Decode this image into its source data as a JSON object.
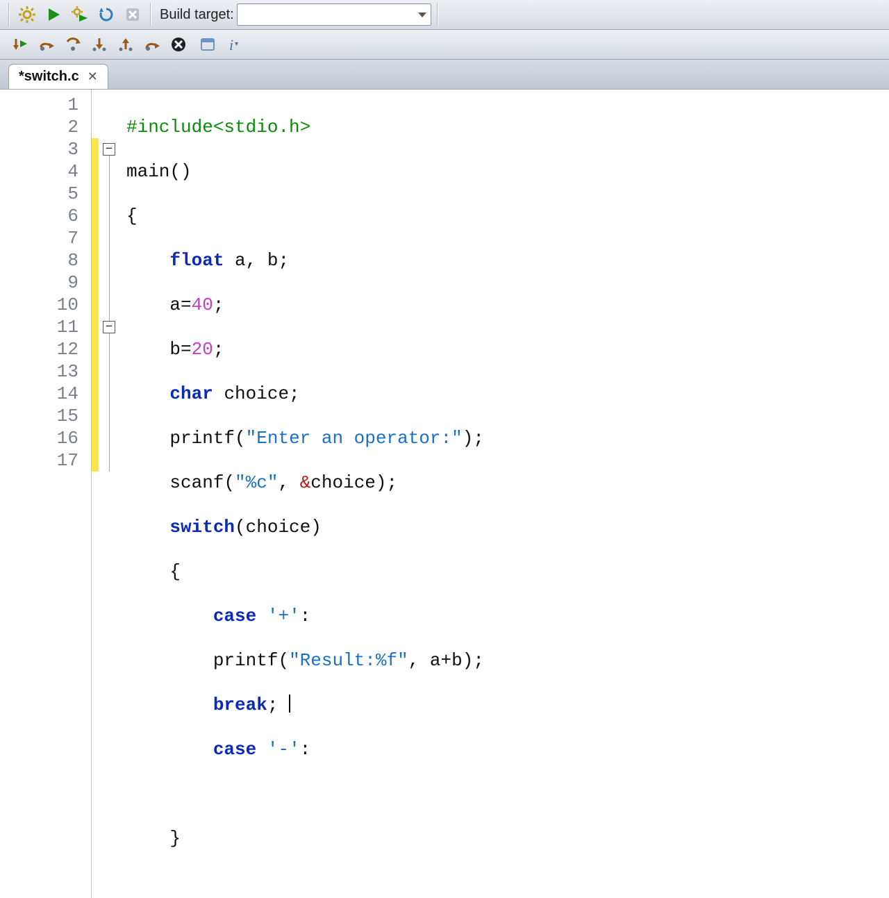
{
  "toolbar": {
    "build_target_label": "Build target:"
  },
  "tab": {
    "title": "*switch.c"
  },
  "icons": {
    "gear": "gear-icon",
    "play": "play-icon",
    "buildrun": "build-run-icon",
    "rebuild": "rebuild-icon",
    "abort": "abort-icon"
  },
  "code": {
    "lines": [
      "1",
      "2",
      "3",
      "4",
      "5",
      "6",
      "7",
      "8",
      "9",
      "10",
      "11",
      "12",
      "13",
      "14",
      "15",
      "16",
      "17"
    ],
    "modified_from": 3,
    "modified_to": 17,
    "include": "#include",
    "include_hdr": "<stdio.h>",
    "main": "main",
    "parens": "()",
    "brace_l": "{",
    "brace_r": "}",
    "kw_float": "float",
    "kw_char": "char",
    "kw_switch": "switch",
    "kw_case": "case",
    "kw_break": "break",
    "id_a": "a",
    "id_b": "b",
    "id_choice": "choice",
    "num_40": "40",
    "num_20": "20",
    "fn_printf": "printf",
    "fn_scanf": "scanf",
    "str_enter": "\"Enter an operator:\"",
    "str_fmtc": "\"%c\"",
    "str_result": "\"Result:%f\"",
    "char_plus": "'+'",
    "char_minus": "'-'",
    "decl_ab": " a, b;",
    "a_eq": "a=",
    "b_eq": "b=",
    "semi": ";",
    "choice_decl": " choice;",
    "printf_open": "(",
    "printf_close": ");",
    "comma_sp": ", ",
    "amp": "&",
    "switch_open": "(choice)",
    "case_colon": ":",
    "aplusb": "a+b",
    "break_suffix": "; "
  }
}
